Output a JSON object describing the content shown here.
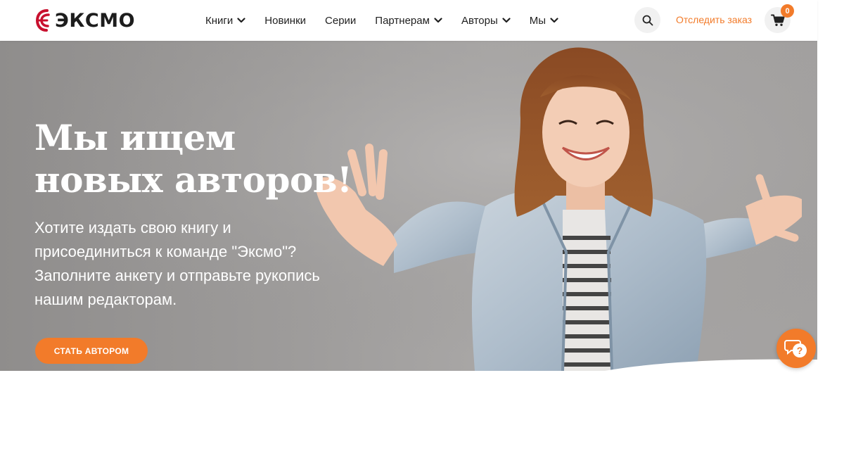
{
  "brand": {
    "name": "ЭКСМО",
    "accent": "#f27b2a",
    "logo_color": "#c8102e"
  },
  "nav": [
    {
      "label": "Книги",
      "has_dropdown": true
    },
    {
      "label": "Новинки",
      "has_dropdown": false
    },
    {
      "label": "Серии",
      "has_dropdown": false
    },
    {
      "label": "Партнерам",
      "has_dropdown": true
    },
    {
      "label": "Авторы",
      "has_dropdown": true
    },
    {
      "label": "Мы",
      "has_dropdown": true
    }
  ],
  "header": {
    "search_icon": "search-icon",
    "track_order_label": "Отследить заказ",
    "cart_icon": "cart-icon",
    "cart_count": "0"
  },
  "hero": {
    "title_lines": [
      "Мы ищем",
      "новых авторов!"
    ],
    "text_lines": [
      "Хотите издать свою книгу и",
      "присоединиться к команде \"Эксмо\"?",
      "Заполните анкету и отправьте рукопись",
      "нашим редакторам."
    ],
    "cta_label": "СТАТЬ АВТОРОМ"
  },
  "help": {
    "icon": "help-chat-icon"
  }
}
